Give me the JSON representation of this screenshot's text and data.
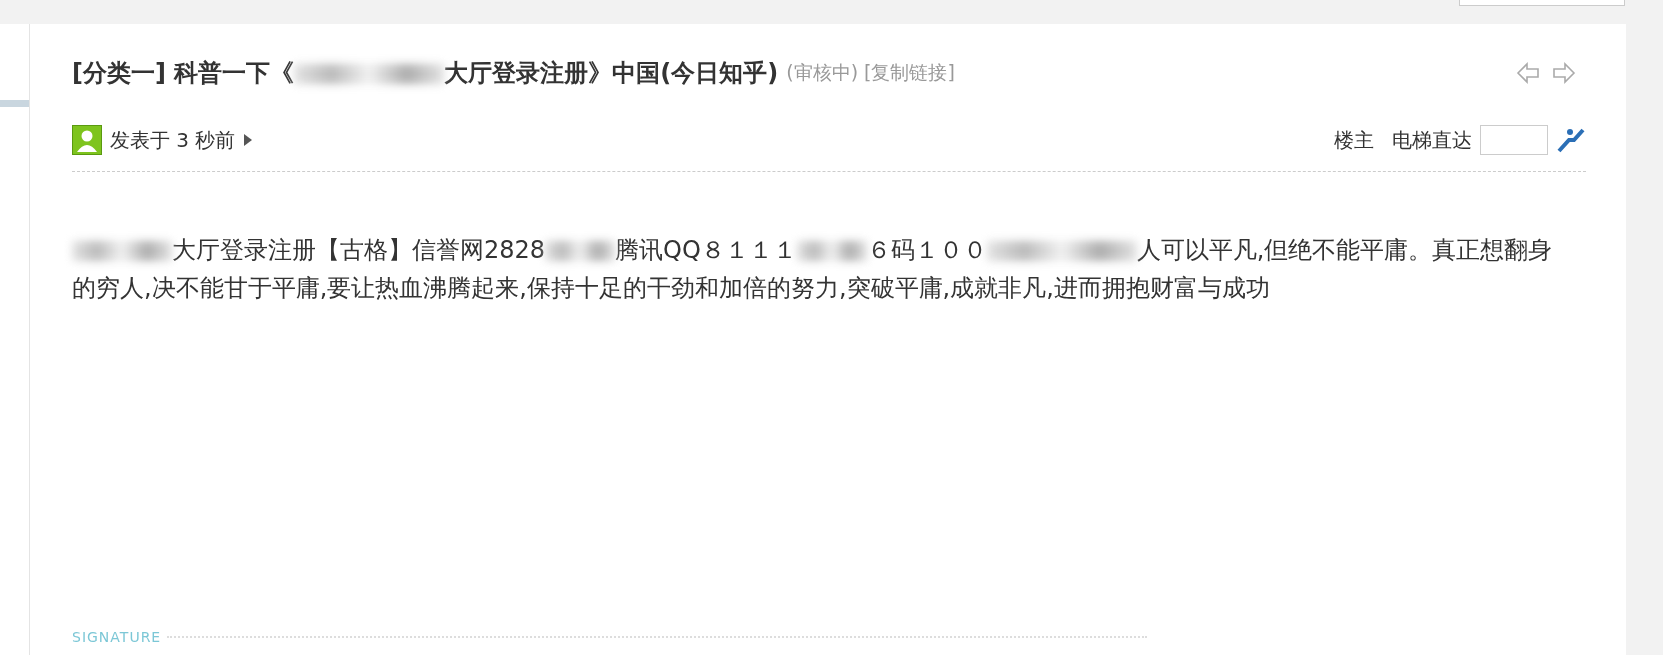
{
  "post": {
    "category": "[分类一]",
    "title_parts": [
      "科普一下《",
      "大厅登录注册》中国(今日知乎)"
    ],
    "status": "(审核中)",
    "copy_link": "[复制链接]",
    "meta": {
      "posted": "发表于 3 秒前",
      "owner_link": "楼主",
      "jump_label": "电梯直达"
    },
    "body_parts": [
      "大厅登录注册【古格】信誉网2828",
      "腾讯QQ８１１１",
      "６码１００",
      "人可以平凡,但绝不能平庸。真正想翻身的穷人,决不能甘于平庸,要让热血沸腾起来,保持十足的干劲和加倍的努力,突破平庸,成就非凡,进而拥抱财富与成功"
    ],
    "signature_label": "SIGNATURE"
  }
}
